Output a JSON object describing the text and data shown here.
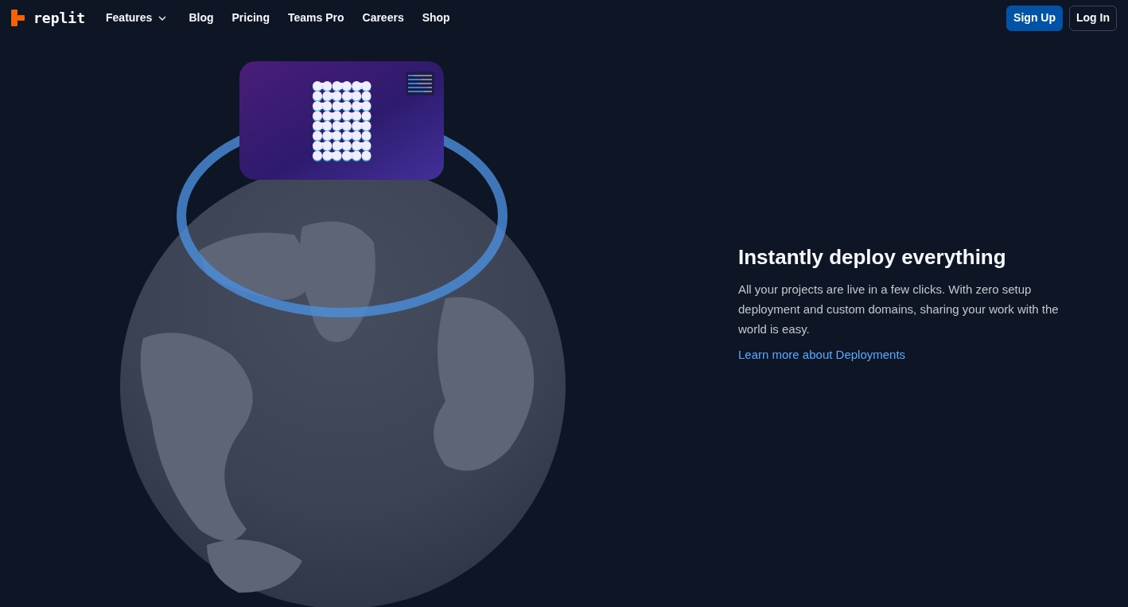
{
  "nav": {
    "logo": "replit",
    "items": [
      {
        "label": "Features",
        "has_dropdown": true
      },
      {
        "label": "Blog",
        "has_dropdown": false
      },
      {
        "label": "Pricing",
        "has_dropdown": false
      },
      {
        "label": "Teams Pro",
        "has_dropdown": false
      },
      {
        "label": "Careers",
        "has_dropdown": false
      },
      {
        "label": "Shop",
        "has_dropdown": false
      }
    ],
    "buttons": [
      {
        "label": "Sign Up",
        "kind": "primary"
      },
      {
        "label": "Log In",
        "kind": "outline"
      }
    ]
  },
  "hero": {
    "heading": "Instantly deploy everything",
    "body": "All your projects are live in a few clicks. With zero setup deployment and custom domains, sharing your work with the world is easy.",
    "link": "Learn more about Deployments"
  }
}
